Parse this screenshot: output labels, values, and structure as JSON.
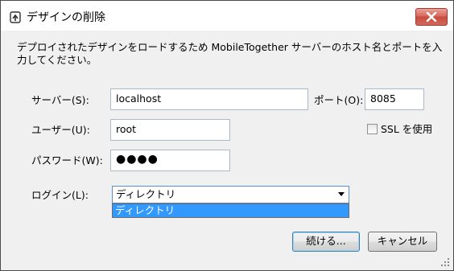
{
  "window": {
    "title": "デザインの削除",
    "close_icon": "close-x-icon"
  },
  "message": "デプロイされたデザインをロードするため MobileTogether サーバーのホスト名とポートを入力してください。",
  "form": {
    "server_label": "サーバー(S):",
    "server_value": "localhost",
    "port_label": "ポート(O):",
    "port_value": "8085",
    "user_label": "ユーザー(U):",
    "user_value": "root",
    "ssl_label": "SSL を使用",
    "ssl_checked": false,
    "password_label": "パスワード(W):",
    "password_mask": "●●●●",
    "login_label": "ログイン(L):",
    "login_selected": "ディレクトリ",
    "login_options": [
      "ディレクトリ"
    ]
  },
  "buttons": {
    "continue": "続ける...",
    "cancel": "キャンセル"
  }
}
